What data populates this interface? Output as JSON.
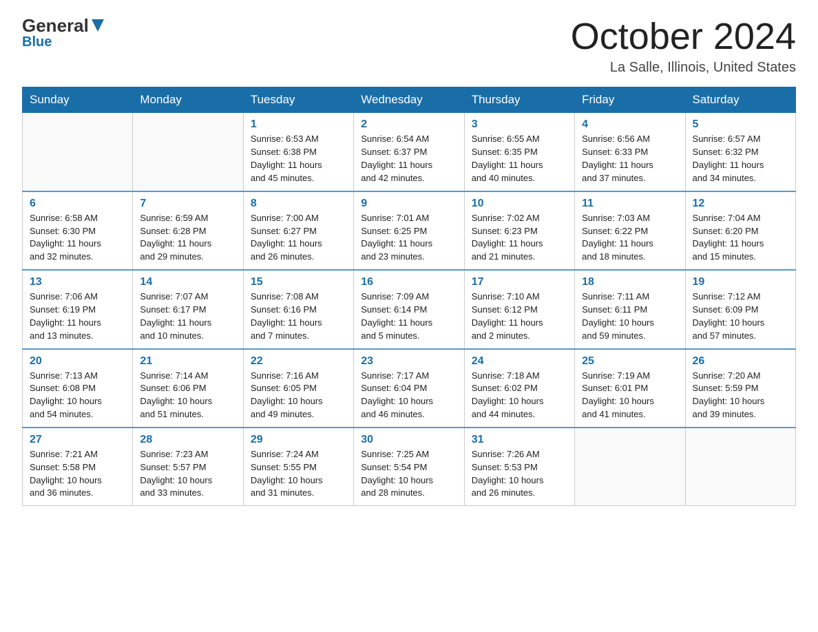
{
  "logo": {
    "general": "General",
    "blue": "Blue"
  },
  "header": {
    "month": "October 2024",
    "location": "La Salle, Illinois, United States"
  },
  "days_of_week": [
    "Sunday",
    "Monday",
    "Tuesday",
    "Wednesday",
    "Thursday",
    "Friday",
    "Saturday"
  ],
  "weeks": [
    [
      {
        "num": "",
        "info": ""
      },
      {
        "num": "",
        "info": ""
      },
      {
        "num": "1",
        "info": "Sunrise: 6:53 AM\nSunset: 6:38 PM\nDaylight: 11 hours\nand 45 minutes."
      },
      {
        "num": "2",
        "info": "Sunrise: 6:54 AM\nSunset: 6:37 PM\nDaylight: 11 hours\nand 42 minutes."
      },
      {
        "num": "3",
        "info": "Sunrise: 6:55 AM\nSunset: 6:35 PM\nDaylight: 11 hours\nand 40 minutes."
      },
      {
        "num": "4",
        "info": "Sunrise: 6:56 AM\nSunset: 6:33 PM\nDaylight: 11 hours\nand 37 minutes."
      },
      {
        "num": "5",
        "info": "Sunrise: 6:57 AM\nSunset: 6:32 PM\nDaylight: 11 hours\nand 34 minutes."
      }
    ],
    [
      {
        "num": "6",
        "info": "Sunrise: 6:58 AM\nSunset: 6:30 PM\nDaylight: 11 hours\nand 32 minutes."
      },
      {
        "num": "7",
        "info": "Sunrise: 6:59 AM\nSunset: 6:28 PM\nDaylight: 11 hours\nand 29 minutes."
      },
      {
        "num": "8",
        "info": "Sunrise: 7:00 AM\nSunset: 6:27 PM\nDaylight: 11 hours\nand 26 minutes."
      },
      {
        "num": "9",
        "info": "Sunrise: 7:01 AM\nSunset: 6:25 PM\nDaylight: 11 hours\nand 23 minutes."
      },
      {
        "num": "10",
        "info": "Sunrise: 7:02 AM\nSunset: 6:23 PM\nDaylight: 11 hours\nand 21 minutes."
      },
      {
        "num": "11",
        "info": "Sunrise: 7:03 AM\nSunset: 6:22 PM\nDaylight: 11 hours\nand 18 minutes."
      },
      {
        "num": "12",
        "info": "Sunrise: 7:04 AM\nSunset: 6:20 PM\nDaylight: 11 hours\nand 15 minutes."
      }
    ],
    [
      {
        "num": "13",
        "info": "Sunrise: 7:06 AM\nSunset: 6:19 PM\nDaylight: 11 hours\nand 13 minutes."
      },
      {
        "num": "14",
        "info": "Sunrise: 7:07 AM\nSunset: 6:17 PM\nDaylight: 11 hours\nand 10 minutes."
      },
      {
        "num": "15",
        "info": "Sunrise: 7:08 AM\nSunset: 6:16 PM\nDaylight: 11 hours\nand 7 minutes."
      },
      {
        "num": "16",
        "info": "Sunrise: 7:09 AM\nSunset: 6:14 PM\nDaylight: 11 hours\nand 5 minutes."
      },
      {
        "num": "17",
        "info": "Sunrise: 7:10 AM\nSunset: 6:12 PM\nDaylight: 11 hours\nand 2 minutes."
      },
      {
        "num": "18",
        "info": "Sunrise: 7:11 AM\nSunset: 6:11 PM\nDaylight: 10 hours\nand 59 minutes."
      },
      {
        "num": "19",
        "info": "Sunrise: 7:12 AM\nSunset: 6:09 PM\nDaylight: 10 hours\nand 57 minutes."
      }
    ],
    [
      {
        "num": "20",
        "info": "Sunrise: 7:13 AM\nSunset: 6:08 PM\nDaylight: 10 hours\nand 54 minutes."
      },
      {
        "num": "21",
        "info": "Sunrise: 7:14 AM\nSunset: 6:06 PM\nDaylight: 10 hours\nand 51 minutes."
      },
      {
        "num": "22",
        "info": "Sunrise: 7:16 AM\nSunset: 6:05 PM\nDaylight: 10 hours\nand 49 minutes."
      },
      {
        "num": "23",
        "info": "Sunrise: 7:17 AM\nSunset: 6:04 PM\nDaylight: 10 hours\nand 46 minutes."
      },
      {
        "num": "24",
        "info": "Sunrise: 7:18 AM\nSunset: 6:02 PM\nDaylight: 10 hours\nand 44 minutes."
      },
      {
        "num": "25",
        "info": "Sunrise: 7:19 AM\nSunset: 6:01 PM\nDaylight: 10 hours\nand 41 minutes."
      },
      {
        "num": "26",
        "info": "Sunrise: 7:20 AM\nSunset: 5:59 PM\nDaylight: 10 hours\nand 39 minutes."
      }
    ],
    [
      {
        "num": "27",
        "info": "Sunrise: 7:21 AM\nSunset: 5:58 PM\nDaylight: 10 hours\nand 36 minutes."
      },
      {
        "num": "28",
        "info": "Sunrise: 7:23 AM\nSunset: 5:57 PM\nDaylight: 10 hours\nand 33 minutes."
      },
      {
        "num": "29",
        "info": "Sunrise: 7:24 AM\nSunset: 5:55 PM\nDaylight: 10 hours\nand 31 minutes."
      },
      {
        "num": "30",
        "info": "Sunrise: 7:25 AM\nSunset: 5:54 PM\nDaylight: 10 hours\nand 28 minutes."
      },
      {
        "num": "31",
        "info": "Sunrise: 7:26 AM\nSunset: 5:53 PM\nDaylight: 10 hours\nand 26 minutes."
      },
      {
        "num": "",
        "info": ""
      },
      {
        "num": "",
        "info": ""
      }
    ]
  ]
}
